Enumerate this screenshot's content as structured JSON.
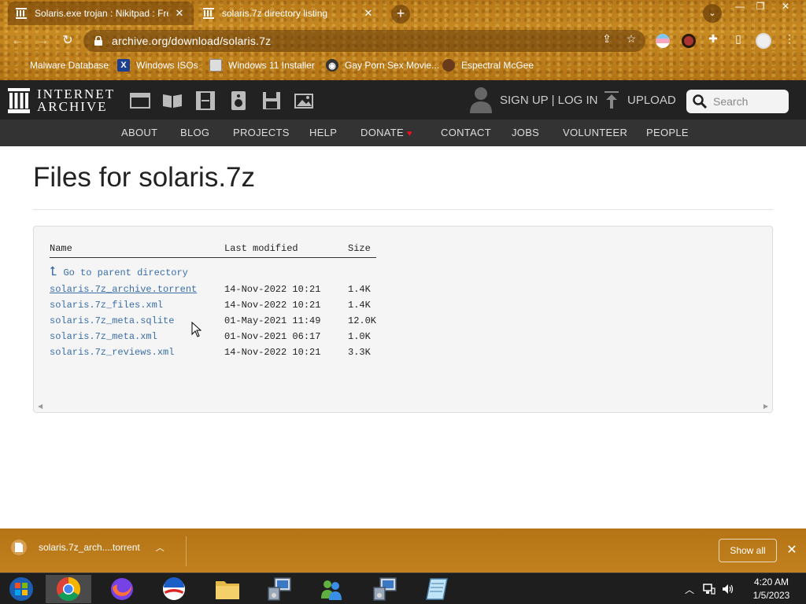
{
  "browser": {
    "tabs": [
      {
        "title": "Solaris.exe trojan : Nikitpad : Fre",
        "active": true,
        "favicon": "archive-icon"
      },
      {
        "title": "solaris.7z directory listing",
        "active": false,
        "favicon": "archive-icon"
      }
    ],
    "address": "archive.org/download/solaris.7z",
    "bookmarks": [
      {
        "label": "Malware Database",
        "icon": "malware-icon"
      },
      {
        "label": "Windows ISOs",
        "icon": "x-icon"
      },
      {
        "label": "Windows 11 Installer",
        "icon": "image-icon"
      },
      {
        "label": "Gay Porn Sex Movie...",
        "icon": "site-icon"
      },
      {
        "label": "Espectral McGee",
        "icon": "avatar-icon"
      }
    ]
  },
  "ia": {
    "logo_line1": "INTERNET",
    "logo_line2": "ARCHIVE",
    "signup": "SIGN UP | LOG IN",
    "upload": "UPLOAD",
    "search_placeholder": "Search",
    "nav": [
      "ABOUT",
      "BLOG",
      "PROJECTS",
      "HELP",
      "DONATE",
      "CONTACT",
      "JOBS",
      "VOLUNTEER",
      "PEOPLE"
    ]
  },
  "page": {
    "title": "Files for solaris.7z",
    "table": {
      "headers": [
        "Name",
        "Last modified",
        "Size"
      ],
      "parent_link": "Go to parent directory",
      "rows": [
        {
          "name": "solaris.7z_archive.torrent",
          "modified": "14-Nov-2022 10:21",
          "size": "1.4K",
          "visited": true
        },
        {
          "name": "solaris.7z_files.xml",
          "modified": "14-Nov-2022 10:21",
          "size": "1.4K",
          "visited": false
        },
        {
          "name": "solaris.7z_meta.sqlite",
          "modified": "01-May-2021 11:49",
          "size": "12.0K",
          "visited": false
        },
        {
          "name": "solaris.7z_meta.xml",
          "modified": "01-Nov-2021 06:17",
          "size": "1.0K",
          "visited": false
        },
        {
          "name": "solaris.7z_reviews.xml",
          "modified": "14-Nov-2022 10:21",
          "size": "3.3K",
          "visited": false
        }
      ]
    }
  },
  "download_shelf": {
    "file": "solaris.7z_arch....torrent",
    "show_all": "Show all"
  },
  "taskbar": {
    "time": "4:20 AM",
    "date": "1/5/2023",
    "apps": [
      "start-orb",
      "chrome",
      "firefox",
      "obama-app",
      "file-explorer",
      "setup-app",
      "messenger",
      "setup-app-2",
      "notepad"
    ]
  },
  "colors": {
    "link": "#3a6ea8",
    "ia_header": "#222222",
    "ia_nav": "#333333",
    "chrome_theme": "#b87918"
  }
}
